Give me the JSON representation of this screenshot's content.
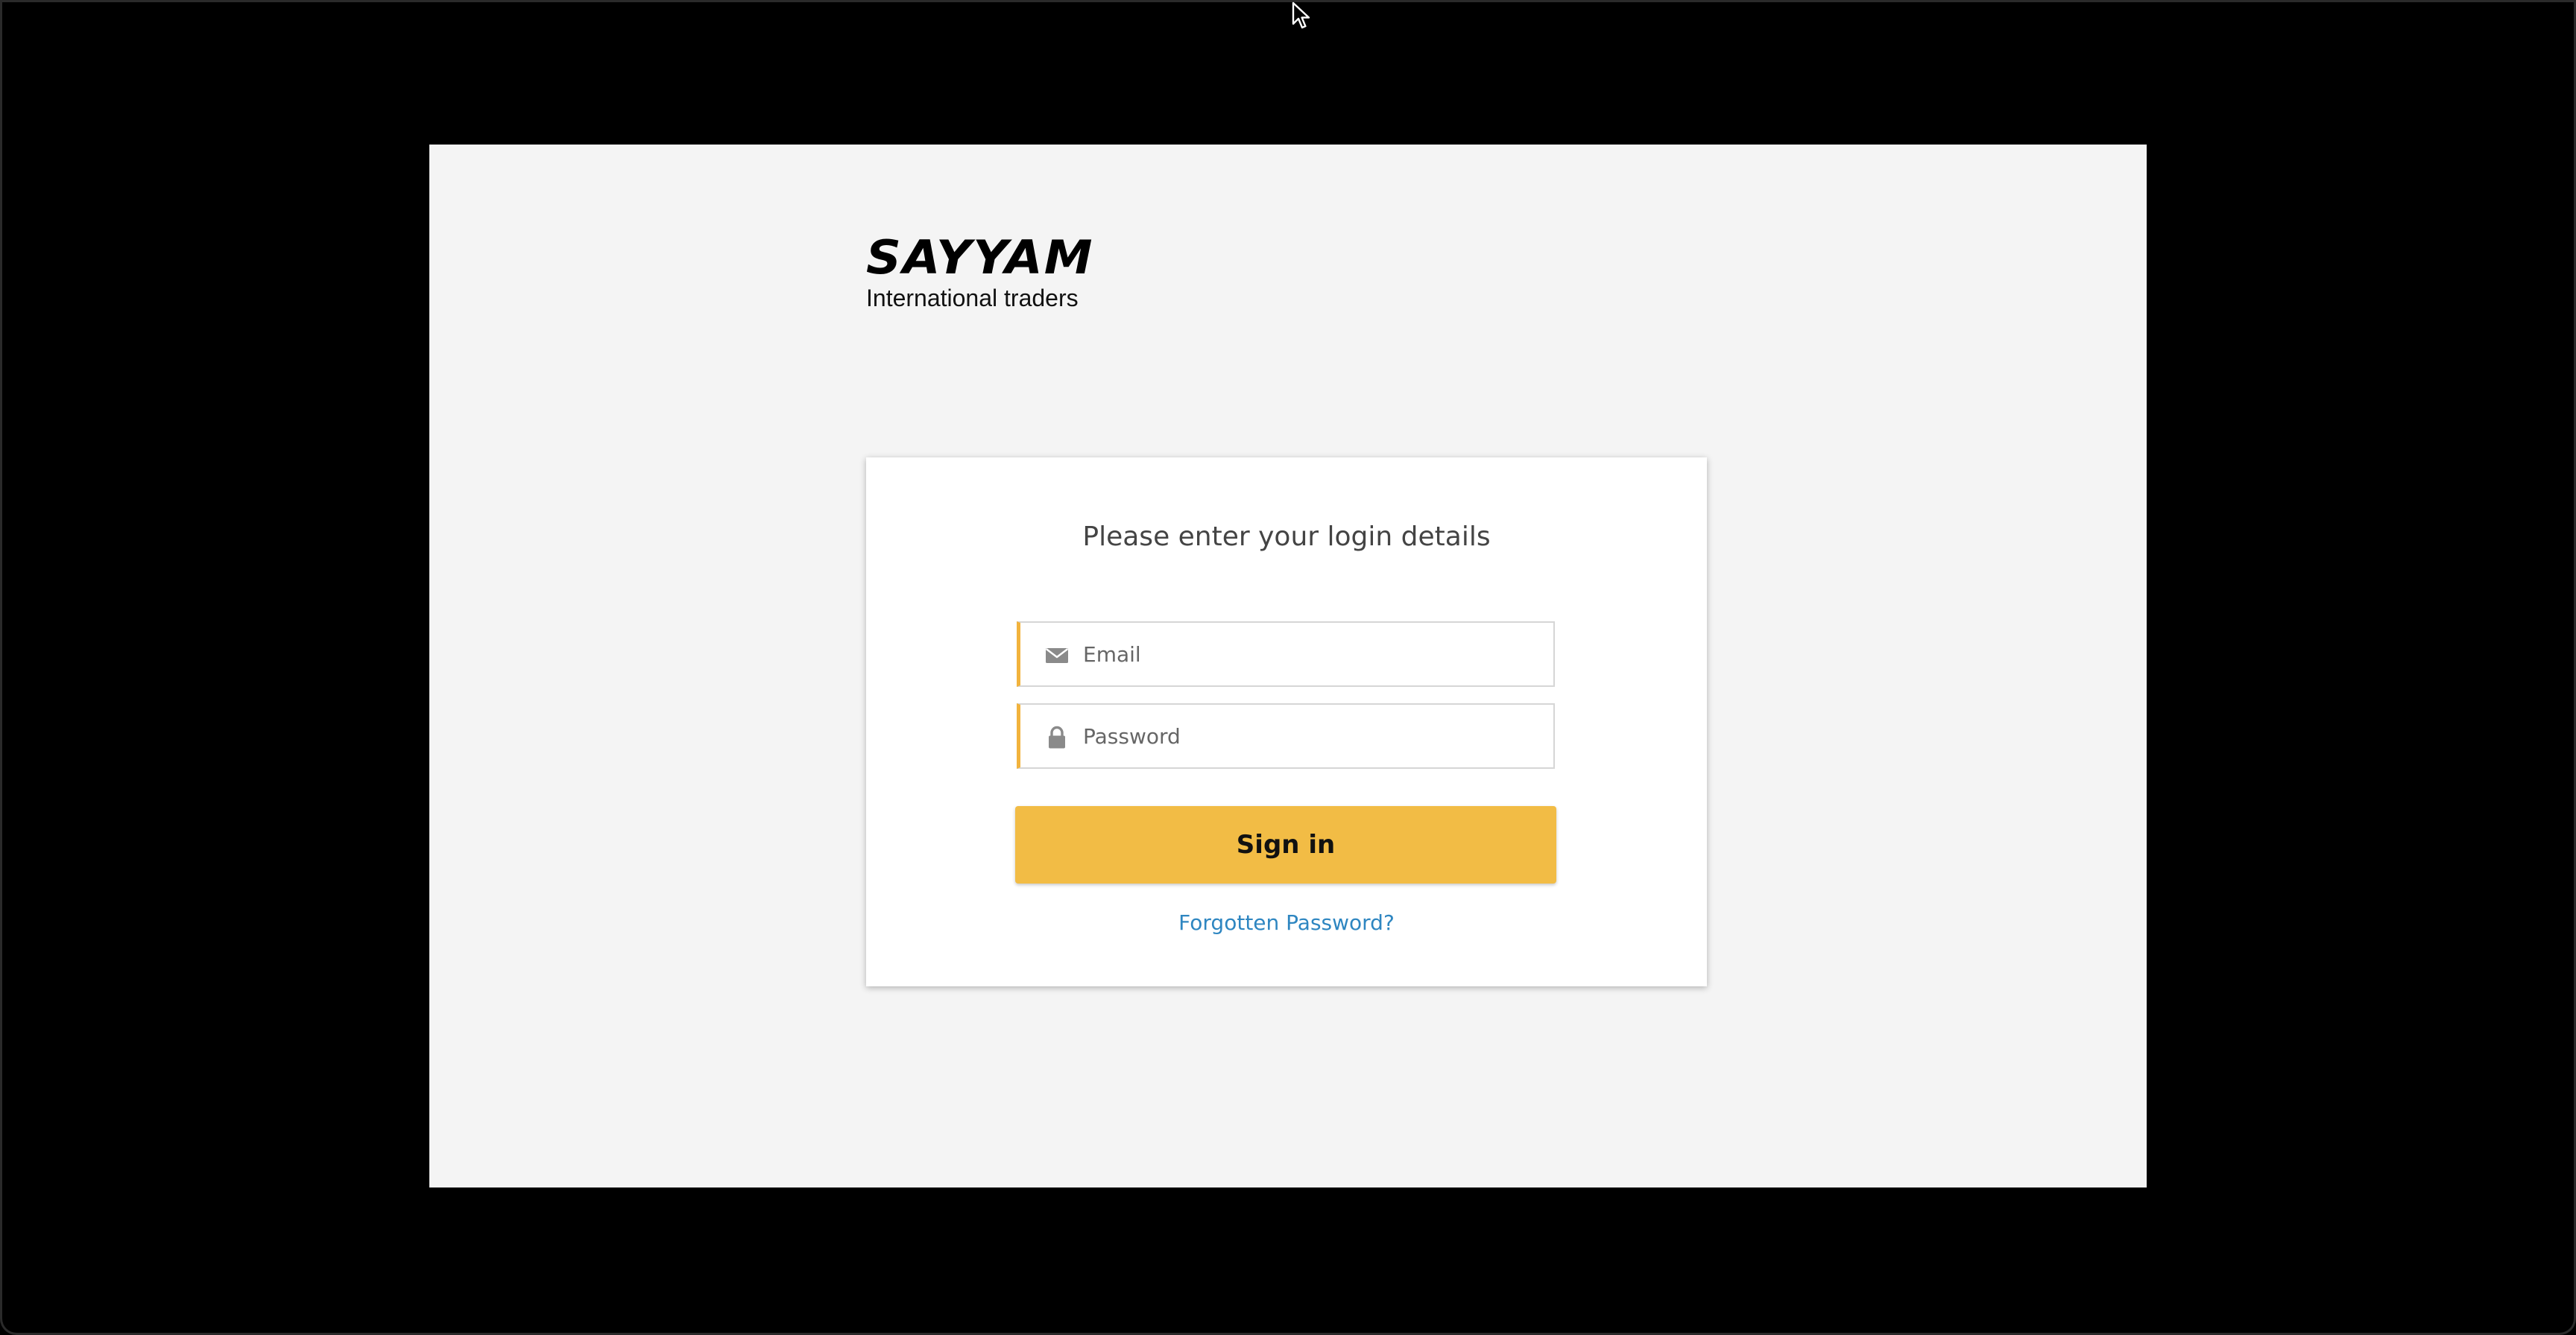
{
  "brand": {
    "name": "SAYYAM",
    "tagline": "International traders"
  },
  "login": {
    "title": "Please enter your login details",
    "email_placeholder": "Email",
    "password_placeholder": "Password",
    "signin_label": "Sign in",
    "forgot_label": "Forgotten Password?"
  },
  "icons": {
    "email": "envelope-icon",
    "password": "lock-icon",
    "cursor": "mouse-pointer-icon"
  },
  "colors": {
    "accent": "#f2bc45",
    "link": "#2e86c1",
    "page_bg": "#f4f4f4",
    "frame_bg": "#000000"
  }
}
